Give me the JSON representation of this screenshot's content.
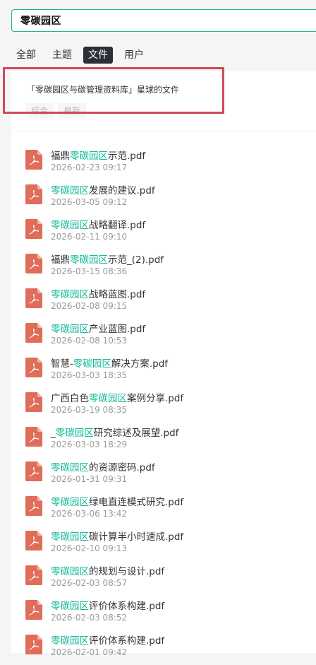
{
  "search": {
    "query": "零碳园区"
  },
  "tabs": [
    {
      "label": "全部",
      "active": false
    },
    {
      "label": "主题",
      "active": false
    },
    {
      "label": "文件",
      "active": true
    },
    {
      "label": "用户",
      "active": false
    }
  ],
  "group": {
    "title": "「零碳园区与碳管理资料库」星球的文件",
    "sort_tabs": [
      "综合",
      "最新"
    ]
  },
  "colors": {
    "accent": "#16b998",
    "pdf_icon": "#e06c5a",
    "highlight_box": "#cf4a57",
    "active_tab_bg": "#2b3038"
  },
  "file_icon": "pdf-file-icon",
  "files": [
    {
      "before": "福鼎",
      "match": "零碳园区",
      "after": "示范.pdf",
      "date": "2026-02-23 09:17"
    },
    {
      "before": "",
      "match": "零碳园区",
      "after": "发展的建议.pdf",
      "date": "2026-03-05 09:12"
    },
    {
      "before": "",
      "match": "零碳园区",
      "after": "战略翻译.pdf",
      "date": "2026-02-11 09:10"
    },
    {
      "before": "福鼎",
      "match": "零碳园区",
      "after": "示范_(2).pdf",
      "date": "2026-03-15 08:36"
    },
    {
      "before": "",
      "match": "零碳园区",
      "after": "战略蓝图.pdf",
      "date": "2026-02-08 09:15"
    },
    {
      "before": "",
      "match": "零碳园区",
      "after": "产业蓝图.pdf",
      "date": "2026-02-08 10:53"
    },
    {
      "before": "智慧-",
      "match": "零碳园区",
      "after": "解决方案.pdf",
      "date": "2026-03-03 18:35"
    },
    {
      "before": "广西白色",
      "match": "零碳园区",
      "after": "案例分享.pdf",
      "date": "2026-03-19 08:35"
    },
    {
      "before": "_",
      "match": "零碳园区",
      "after": "研究综述及展望.pdf",
      "date": "2026-03-03 18:29"
    },
    {
      "before": "",
      "match": "零碳园区",
      "after": "的资源密码.pdf",
      "date": "2026-01-31 09:31"
    },
    {
      "before": "",
      "match": "零碳园区",
      "after": "绿电直连模式研究.pdf",
      "date": "2026-03-06 13:42"
    },
    {
      "before": "",
      "match": "零碳园区",
      "after": "碳计算半小时速成.pdf",
      "date": "2026-02-10 09:13"
    },
    {
      "before": "",
      "match": "零碳园区",
      "after": "的规划与设计.pdf",
      "date": "2026-02-03 08:57"
    },
    {
      "before": "",
      "match": "零碳园区",
      "after": "评价体系构建.pdf",
      "date": "2026-02-03 08:52"
    },
    {
      "before": "",
      "match": "零碳园区",
      "after": "评价体系构建.pdf",
      "date": "2026-02-01 09:42"
    }
  ]
}
